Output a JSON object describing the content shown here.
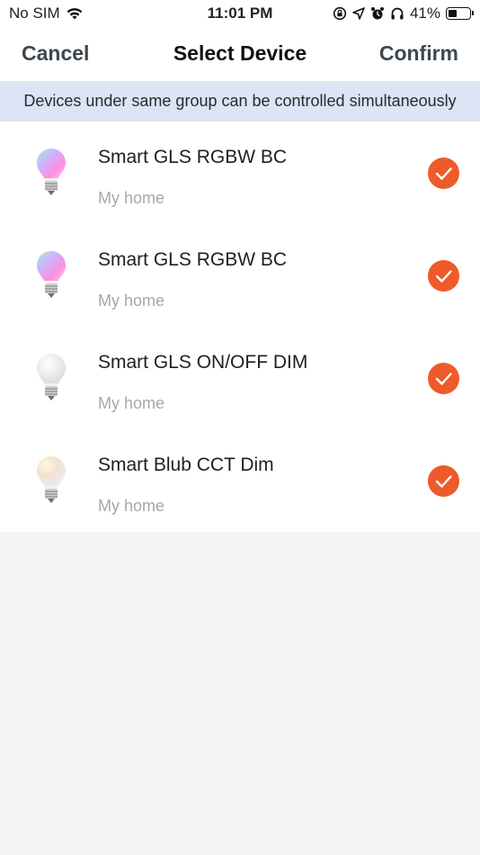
{
  "status_bar": {
    "carrier": "No SIM",
    "time": "11:01 PM",
    "battery_percent": "41%",
    "battery_level": 0.41,
    "icons": [
      "wifi-icon",
      "rotation-lock-icon",
      "location-arrow-icon",
      "alarm-icon",
      "headphones-icon",
      "battery-icon"
    ]
  },
  "nav": {
    "cancel_label": "Cancel",
    "title": "Select Device",
    "confirm_label": "Confirm"
  },
  "banner": {
    "text": "Devices under same group can be controlled simultaneously"
  },
  "devices": [
    {
      "name": "Smart GLS RGBW BC",
      "location": "My home",
      "icon": "rgbw-bulb-icon",
      "selected": true
    },
    {
      "name": "Smart GLS RGBW BC",
      "location": "My home",
      "icon": "rgbw-bulb-icon",
      "selected": true
    },
    {
      "name": "Smart GLS ON/OFF DIM",
      "location": "My home",
      "icon": "white-bulb-icon",
      "selected": true
    },
    {
      "name": "Smart Blub CCT Dim",
      "location": "My home",
      "icon": "cct-bulb-icon",
      "selected": true
    }
  ],
  "colors": {
    "accent": "#ef5a2a",
    "banner_bg": "#dbe5f6",
    "nav_text": "#3d4750",
    "secondary_text": "#a7a7a7",
    "page_bg": "#f5f5f5"
  }
}
